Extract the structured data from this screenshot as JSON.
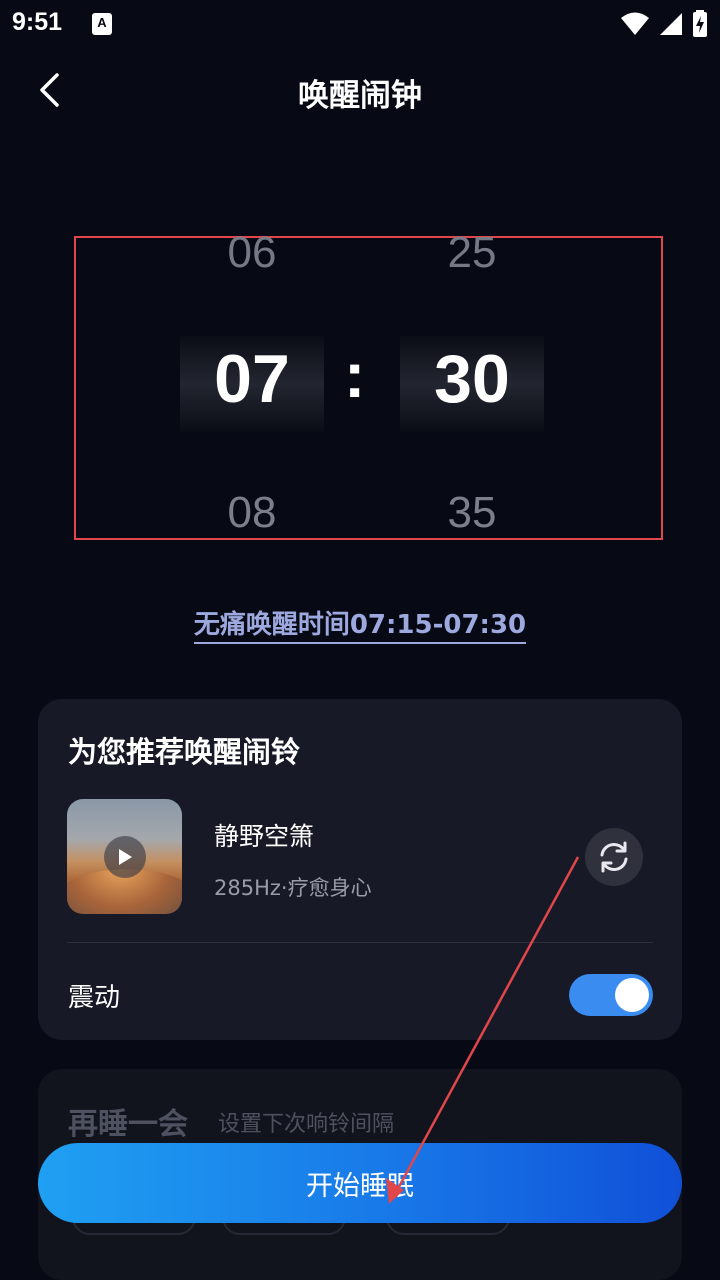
{
  "status_bar": {
    "time": "9:51",
    "notification_icon_letter": "A",
    "icons": [
      "wifi-icon",
      "signal-icon",
      "battery-charging-icon"
    ]
  },
  "header": {
    "back_icon": "chevron-left-icon",
    "title": "唤醒闹钟"
  },
  "time_picker": {
    "hour": {
      "above": "06",
      "selected": "07",
      "below": "08"
    },
    "separator": ":",
    "minute": {
      "above": "25",
      "selected": "30",
      "below": "35"
    }
  },
  "wake_window": {
    "text": "无痛唤醒时间07:15-07:30"
  },
  "recommend": {
    "heading": "为您推荐唤醒闹铃",
    "track_name": "静野空箫",
    "track_subtitle": "285Hz·疗愈身心",
    "refresh_icon": "refresh-icon",
    "vibrate_label": "震动",
    "vibrate_on": true
  },
  "snooze": {
    "title": "再睡一会",
    "hint": "设置下次响铃间隔"
  },
  "start_button": {
    "label": "开始睡眠"
  },
  "colors": {
    "background": "#070a14",
    "card": "#171a26",
    "accent_blue": "#1878e8",
    "toggle_on": "#3b8cf0",
    "wake_text": "#9da8de",
    "annotation_red": "#e0464a"
  }
}
